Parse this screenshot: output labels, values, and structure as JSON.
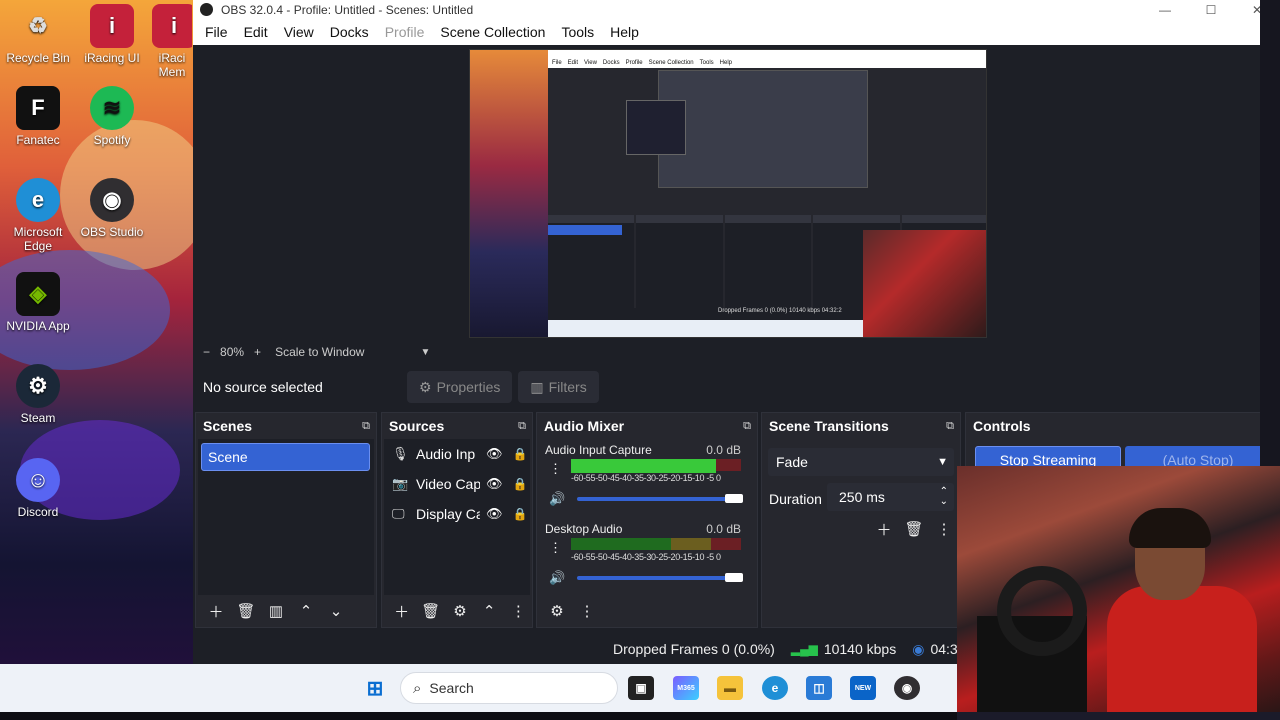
{
  "desktop": {
    "icons": [
      {
        "label": "Recycle Bin",
        "glyph": "♻"
      },
      {
        "label": "iRacing UI",
        "glyph": "i"
      },
      {
        "label": "iRaci Mem",
        "glyph": "i"
      },
      {
        "label": "Fanatec",
        "glyph": "F"
      },
      {
        "label": "Spotify",
        "glyph": "≋"
      },
      {
        "label": "Microsoft Edge",
        "glyph": "e"
      },
      {
        "label": "OBS Studio",
        "glyph": "◉"
      },
      {
        "label": "NVIDIA App",
        "glyph": "◈"
      },
      {
        "label": "Steam",
        "glyph": "⚙"
      },
      {
        "label": "Discord",
        "glyph": "☺"
      }
    ]
  },
  "window": {
    "title": "OBS 32.0.4 - Profile: Untitled - Scenes: Untitled",
    "minimize": "—",
    "maximize": "☐",
    "close": "✕"
  },
  "menu": [
    "File",
    "Edit",
    "View",
    "Docks",
    "Profile",
    "Scene Collection",
    "Tools",
    "Help"
  ],
  "preview": {
    "nested_menu": [
      "File",
      "Edit",
      "View",
      "Docks",
      "Profile",
      "Scene Collection",
      "Tools",
      "Help"
    ],
    "nested_status": "Dropped Frames 0 (0.0%)  10140 kbps  04:32:2"
  },
  "zoom": {
    "minus": "−",
    "level": "80%",
    "plus": "+",
    "mode": "Scale to Window"
  },
  "source_toolbar": {
    "no_source": "No source selected",
    "properties": "Properties",
    "filters": "Filters"
  },
  "scenes": {
    "title": "Scenes",
    "items": [
      "Scene"
    ]
  },
  "sources": {
    "title": "Sources",
    "items": [
      {
        "name": "Audio Inp",
        "icon": "mic-icon"
      },
      {
        "name": "Video Cap",
        "icon": "camera-icon"
      },
      {
        "name": "Display Ca",
        "icon": "monitor-icon"
      }
    ]
  },
  "mixer": {
    "title": "Audio Mixer",
    "channels": [
      {
        "name": "Audio Input Capture",
        "db": "0.0 dB",
        "level": 0.85
      },
      {
        "name": "Desktop Audio",
        "db": "0.0 dB",
        "level": 0.0
      }
    ],
    "scale": "-60-55-50-45-40-35-30-25-20-15-10 -5  0"
  },
  "transitions": {
    "title": "Scene Transitions",
    "selected": "Fade",
    "duration_label": "Duration",
    "duration_value": "250 ms"
  },
  "controls": {
    "title": "Controls",
    "stop_streaming": "Stop Streaming",
    "auto_stop": "(Auto Stop)"
  },
  "status": {
    "dropped_frames": "Dropped Frames 0 (0.0%)",
    "bitrate": "10140 kbps",
    "stream_time": "04:32:2"
  },
  "taskbar": {
    "search_placeholder": "Search",
    "m365_label": "M365",
    "outlook_badge": "NEW"
  },
  "colors": {
    "accent": "#3463d3",
    "meter_green": "#39c93a",
    "meter_yellow": "#c9b33a",
    "meter_red": "#c9303a"
  }
}
